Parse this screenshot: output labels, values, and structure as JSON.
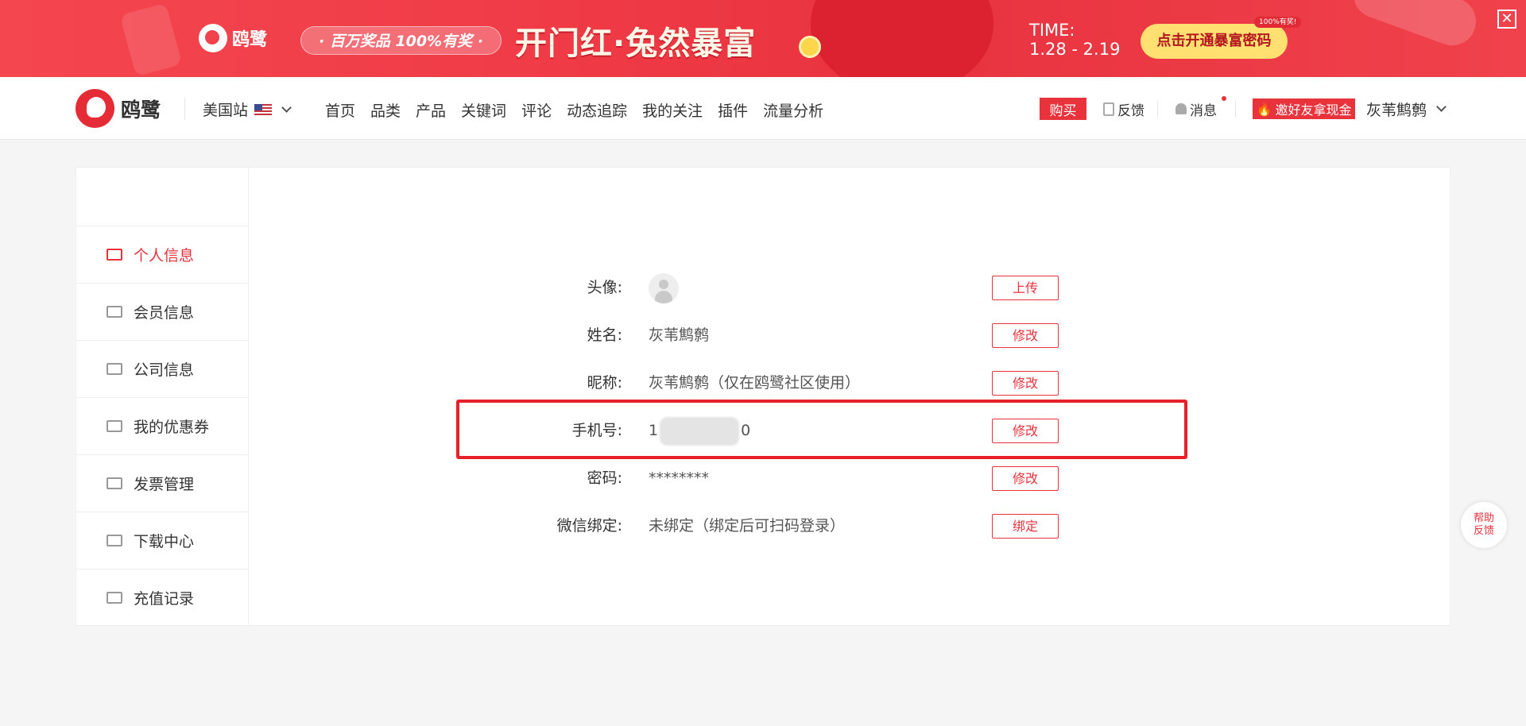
{
  "banner": {
    "brand": "鸥鹭",
    "pill": "· 百万奖品 100%有奖 ·",
    "title": "开门红·兔然暴富",
    "time_label": "TIME:",
    "time_range": "1.28 - 2.19",
    "cta": "点击开通暴富密码",
    "cta_tag": "100%有奖!",
    "close": "✕"
  },
  "nav": {
    "brand": "鸥鹭",
    "site": "美国站",
    "menu": [
      "首页",
      "品类",
      "产品",
      "关键词",
      "评论",
      "动态追踪",
      "我的关注",
      "插件",
      "流量分析"
    ],
    "buy": "购买",
    "feedback": "反馈",
    "messages": "消息",
    "invite": "邀好友拿现金",
    "user": "灰苇鹪鹩"
  },
  "sidebar": {
    "items": [
      {
        "label": "个人信息",
        "icon": "id-card-icon",
        "active": true
      },
      {
        "label": "会员信息",
        "icon": "diamond-icon",
        "active": false
      },
      {
        "label": "公司信息",
        "icon": "building-icon",
        "active": false
      },
      {
        "label": "我的优惠券",
        "icon": "ticket-icon",
        "active": false
      },
      {
        "label": "发票管理",
        "icon": "invoice-icon",
        "active": false
      },
      {
        "label": "下载中心",
        "icon": "cloud-download-icon",
        "active": false
      },
      {
        "label": "充值记录",
        "icon": "cloud-download-icon",
        "active": false
      }
    ]
  },
  "profile": {
    "avatar": {
      "label": "头像:",
      "button": "上传"
    },
    "name": {
      "label": "姓名:",
      "value": "灰苇鹪鹩",
      "button": "修改"
    },
    "nickname": {
      "label": "昵称:",
      "value": "灰苇鹪鹩（仅在鸥鹭社区使用）",
      "button": "修改"
    },
    "phone": {
      "label": "手机号:",
      "value_start": "1",
      "value_end": "0",
      "button": "修改"
    },
    "password": {
      "label": "密码:",
      "value": "********",
      "button": "修改"
    },
    "wechat": {
      "label": "微信绑定:",
      "value": "未绑定（绑定后可扫码登录）",
      "button": "绑定"
    }
  },
  "help": {
    "line1": "帮助",
    "line2": "反馈"
  },
  "colors": {
    "accent": "#e8323c",
    "highlight": "#e8202a"
  }
}
